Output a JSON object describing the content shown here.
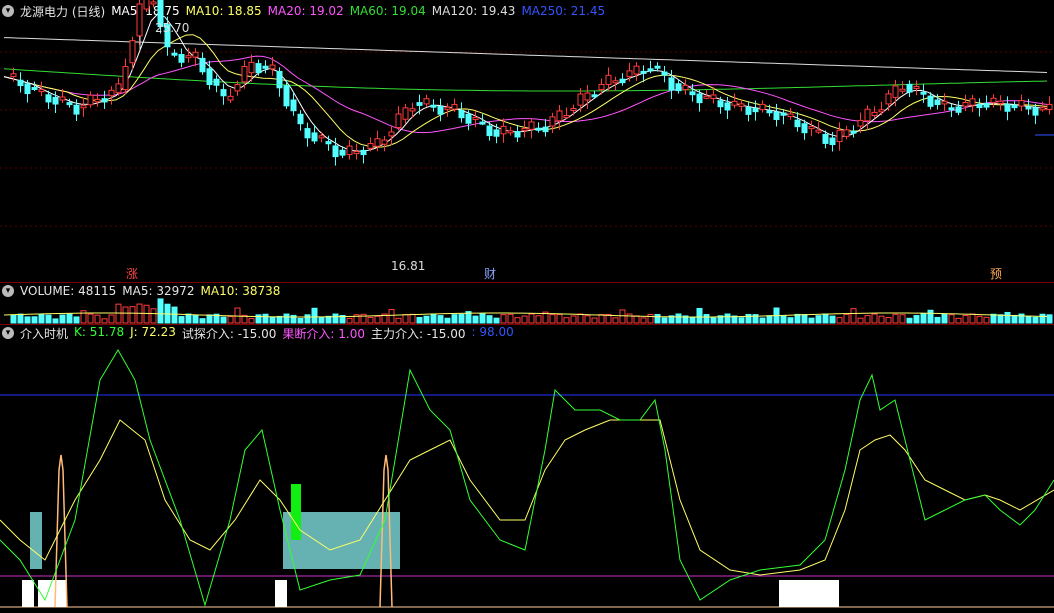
{
  "main_panel": {
    "title": "龙源电力 (日线)",
    "ma": [
      {
        "label": "MA5: 18.75",
        "color": "#ffffff"
      },
      {
        "label": "MA10: 18.85",
        "color": "#ffff66"
      },
      {
        "label": "MA20: 19.02",
        "color": "#ff55ff"
      },
      {
        "label": "MA60: 19.04",
        "color": "#33dd33"
      },
      {
        "label": "MA120: 19.43",
        "color": "#dddddd"
      },
      {
        "label": "MA250: 21.45",
        "color": "#3355ff"
      }
    ],
    "high_label": "25.70",
    "low_label": "16.81",
    "markers": [
      {
        "text": "涨",
        "color": "#ff4444"
      },
      {
        "text": "财",
        "color": "#8aa2ff"
      },
      {
        "text": "预",
        "color": "#ffaa55"
      }
    ]
  },
  "volume_panel": {
    "items": [
      {
        "label": "VOLUME: 48115",
        "color": "#e6e6e6"
      },
      {
        "label": "MA5: 32972",
        "color": "#e6e6e6"
      },
      {
        "label": "MA10: 38738",
        "color": "#ffff66"
      }
    ]
  },
  "indicator_panel": {
    "items": [
      {
        "label": "介入时机",
        "color": "#e6e6e6"
      },
      {
        "label": "K: 51.78",
        "color": "#33ff33"
      },
      {
        "label": "J: 72.23",
        "color": "#ffff66"
      },
      {
        "label": "试探介入: -15.00",
        "color": "#e6e6e6"
      },
      {
        "label": "果断介入: 1.00",
        "color": "#ff55ff"
      },
      {
        "label": "主力介入: -15.00",
        "color": "#e6e6e6"
      },
      {
        "label": ": 98.00",
        "color": "#3355ff"
      }
    ]
  },
  "colors": {
    "up": "#ff3b3b",
    "down": "#54ffff",
    "background": "#000000"
  }
}
